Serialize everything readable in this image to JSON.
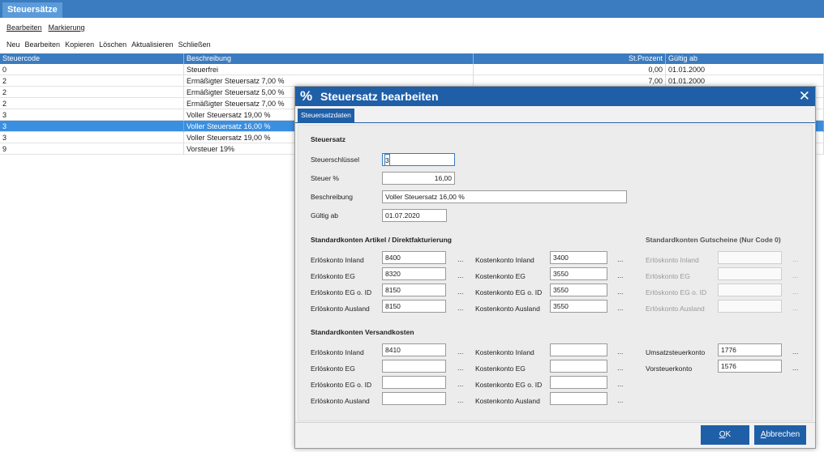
{
  "window": {
    "title": "Steuersätze"
  },
  "menu": {
    "edit": "Bearbeiten",
    "mark": "Markierung"
  },
  "toolbar": [
    "Neu",
    "Bearbeiten",
    "Kopieren",
    "Löschen",
    "Aktualisieren",
    "Schließen"
  ],
  "grid": {
    "headers": {
      "code": "Steuercode",
      "desc": "Beschreibung",
      "pct": "St.Prozent",
      "date": "Gültig ab"
    },
    "rows": [
      {
        "code": "0",
        "desc": "Steuerfrei",
        "pct": "0,00",
        "date": "01.01.2000"
      },
      {
        "code": "2",
        "desc": "Ermäßigter Steuersatz 7,00 %",
        "pct": "7,00",
        "date": "01.01.2000"
      },
      {
        "code": "2",
        "desc": "Ermäßigter Steuersatz 5,00 %",
        "pct": "",
        "date": ""
      },
      {
        "code": "2",
        "desc": "Ermäßigter Steuersatz 7,00 %",
        "pct": "",
        "date": ""
      },
      {
        "code": "3",
        "desc": "Voller Steuersatz 19,00 %",
        "pct": "",
        "date": ""
      },
      {
        "code": "3",
        "desc": "Voller Steuersatz 16,00 %",
        "pct": "",
        "date": ""
      },
      {
        "code": "3",
        "desc": "Voller Steuersatz 19,00 %",
        "pct": "",
        "date": ""
      },
      {
        "code": "9",
        "desc": "Vorsteuer 19%",
        "pct": "",
        "date": ""
      }
    ]
  },
  "dialog": {
    "icon": "%",
    "title": "Steuersatz bearbeiten",
    "close": "✕",
    "tab": "Steuersatzdaten",
    "steuersatz": {
      "section": "Steuersatz",
      "key_label": "Steuerschlüssel",
      "key_value": "3",
      "pct_label": "Steuer %",
      "pct_value": "16,00",
      "desc_label": "Beschreibung",
      "desc_value": "Voller Steuersatz 16,00 %",
      "date_label": "Gültig ab",
      "date_value": "01.07.2020"
    },
    "artikel": {
      "section": "Standardkonten Artikel / Direktfakturierung",
      "left": [
        {
          "label": "Erlöskonto Inland",
          "value": "8400"
        },
        {
          "label": "Erlöskonto EG",
          "value": "8320"
        },
        {
          "label": "Erlöskonto EG o. ID",
          "value": "8150"
        },
        {
          "label": "Erlöskonto Ausland",
          "value": "8150"
        }
      ],
      "right": [
        {
          "label": "Kostenkonto Inland",
          "value": "3400"
        },
        {
          "label": "Kostenkonto EG",
          "value": "3550"
        },
        {
          "label": "Kostenkonto EG o. ID",
          "value": "3550"
        },
        {
          "label": "Kostenkonto Ausland",
          "value": "3550"
        }
      ]
    },
    "gutscheine": {
      "section": "Standardkonten Gutscheine (Nur Code 0)",
      "rows": [
        {
          "label": "Erlöskonto Inland",
          "value": ""
        },
        {
          "label": "Erlöskonto EG",
          "value": ""
        },
        {
          "label": "Erlöskonto EG o. ID",
          "value": ""
        },
        {
          "label": "Erlöskonto Ausland",
          "value": ""
        }
      ]
    },
    "versand": {
      "section": "Standardkonten Versandkosten",
      "left": [
        {
          "label": "Erlöskonto Inland",
          "value": "8410"
        },
        {
          "label": "Erlöskonto EG",
          "value": ""
        },
        {
          "label": "Erlöskonto EG o. ID",
          "value": ""
        },
        {
          "label": "Erlöskonto Ausland",
          "value": ""
        }
      ],
      "right": [
        {
          "label": "Kostenkonto Inland",
          "value": ""
        },
        {
          "label": "Kostenkonto EG",
          "value": ""
        },
        {
          "label": "Kostenkonto EG o. ID",
          "value": ""
        },
        {
          "label": "Kostenkonto Ausland",
          "value": ""
        }
      ]
    },
    "steuerkonten": [
      {
        "label": "Umsatzsteuerkonto",
        "value": "1776"
      },
      {
        "label": "Vorsteuerkonto",
        "value": "1576"
      }
    ],
    "dots": "...",
    "ok": {
      "accel": "O",
      "rest": "K"
    },
    "cancel": {
      "accel": "A",
      "rest": "bbrechen"
    }
  }
}
